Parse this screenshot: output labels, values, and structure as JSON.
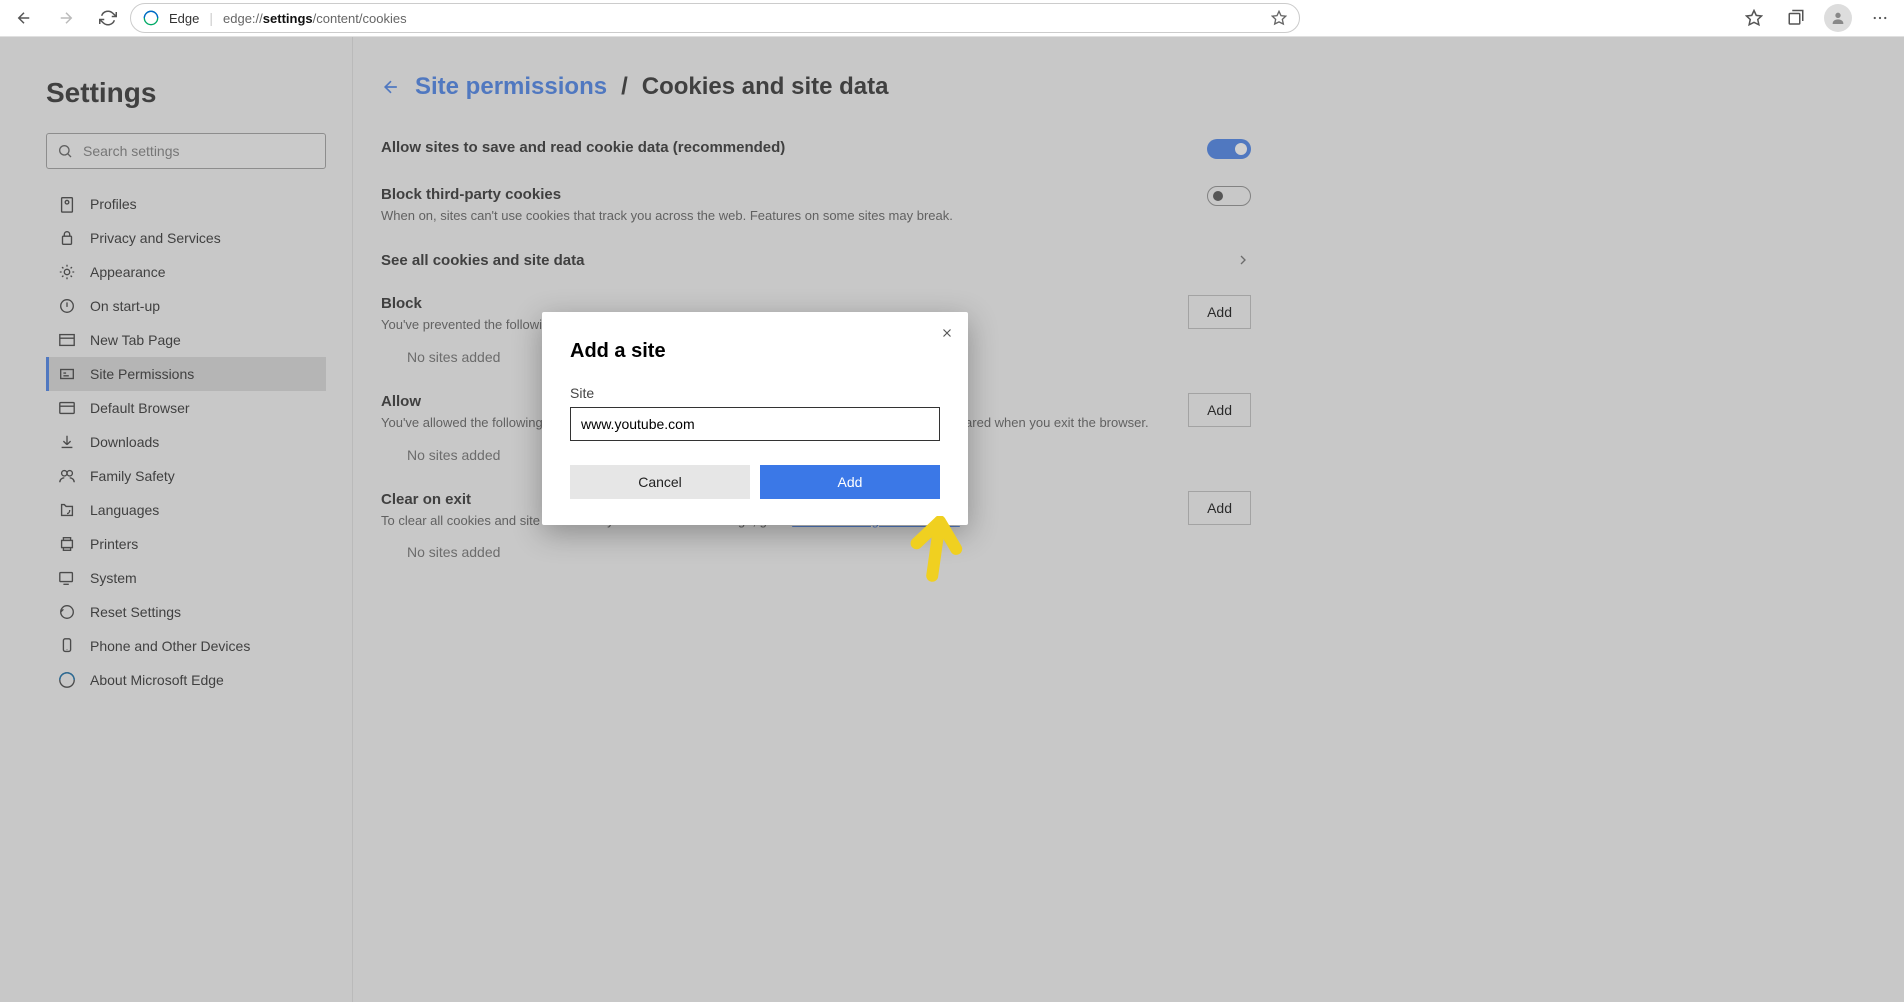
{
  "toolbar": {
    "back_label": "Back",
    "app_name": "Edge",
    "url_prefix": "edge://",
    "url_bold": "settings",
    "url_suffix": "/content/cookies"
  },
  "sidebar": {
    "title": "Settings",
    "search_placeholder": "Search settings",
    "items": [
      {
        "label": "Profiles"
      },
      {
        "label": "Privacy and Services"
      },
      {
        "label": "Appearance"
      },
      {
        "label": "On start-up"
      },
      {
        "label": "New Tab Page"
      },
      {
        "label": "Site Permissions"
      },
      {
        "label": "Default Browser"
      },
      {
        "label": "Downloads"
      },
      {
        "label": "Family Safety"
      },
      {
        "label": "Languages"
      },
      {
        "label": "Printers"
      },
      {
        "label": "System"
      },
      {
        "label": "Reset Settings"
      },
      {
        "label": "Phone and Other Devices"
      },
      {
        "label": "About Microsoft Edge"
      }
    ]
  },
  "breadcrumb": {
    "parent": "Site permissions",
    "sep": "/",
    "current": "Cookies and site data"
  },
  "settings": {
    "allow_cookies": {
      "title": "Allow sites to save and read cookie data (recommended)",
      "on": true
    },
    "block_third": {
      "title": "Block third-party cookies",
      "desc": "When on, sites can't use cookies that track you across the web. Features on some sites may break.",
      "on": false
    },
    "see_all": {
      "title": "See all cookies and site data"
    },
    "block_section": {
      "title": "Block",
      "desc": "You've prevented the following sites from saving and reading cookies on your device.",
      "add_label": "Add",
      "empty": "No sites added"
    },
    "allow_section": {
      "title": "Allow",
      "desc_prefix": "You've allowed the following sites to save cookies on your device. Cookies for these sites won't be cleared when you exit the browser.",
      "add_label": "Add",
      "empty": "No sites added"
    },
    "clear_section": {
      "title": "Clear on exit",
      "desc_prefix": "To clear all cookies and site data when you close Microsoft Edge, go to ",
      "desc_link": "Clear browsing data on close",
      "desc_suffix": ".",
      "add_label": "Add",
      "empty": "No sites added"
    }
  },
  "dialog": {
    "title": "Add a site",
    "label": "Site",
    "value": "www.youtube.com",
    "cancel": "Cancel",
    "add": "Add"
  }
}
